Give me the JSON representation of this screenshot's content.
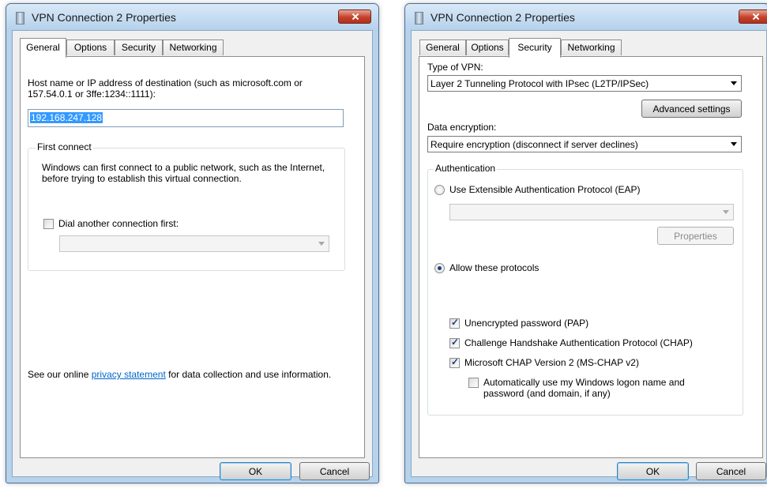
{
  "general_dialog": {
    "title": "VPN Connection 2 Properties",
    "tabs": [
      "General",
      "Options",
      "Security",
      "Networking"
    ],
    "active_tab": "General",
    "host_label": "Host name or IP address of destination (such as microsoft.com or 157.54.0.1 or 3ffe:1234::1111):",
    "host_value": "192.168.247.128",
    "first_connect": {
      "legend": "First connect",
      "description": "Windows can first connect to a public network, such as the Internet, before trying to establish this virtual connection.",
      "dial_label": "Dial another connection first:",
      "dial_checked": false,
      "dial_value": ""
    },
    "privacy_prefix": "See our online ",
    "privacy_link": "privacy statement",
    "privacy_suffix": " for data collection and use information.",
    "ok_label": "OK",
    "cancel_label": "Cancel"
  },
  "security_dialog": {
    "title": "VPN Connection 2 Properties",
    "tabs": [
      "General",
      "Options",
      "Security",
      "Networking"
    ],
    "active_tab": "Security",
    "vpn_type_label": "Type of VPN:",
    "vpn_type_value": "Layer 2 Tunneling Protocol with IPsec (L2TP/IPSec)",
    "advanced_label": "Advanced settings",
    "encryption_label": "Data encryption:",
    "encryption_value": "Require encryption (disconnect if server declines)",
    "authentication": {
      "legend": "Authentication",
      "eap_label": "Use Extensible Authentication Protocol (EAP)",
      "eap_selected": false,
      "eap_value": "",
      "properties_label": "Properties",
      "allow_label": "Allow these protocols",
      "allow_selected": true,
      "protocols": [
        {
          "label": "Unencrypted password (PAP)",
          "checked": true
        },
        {
          "label": "Challenge Handshake Authentication Protocol (CHAP)",
          "checked": true
        },
        {
          "label": "Microsoft CHAP Version 2 (MS-CHAP v2)",
          "checked": true
        }
      ],
      "auto_logon_label": "Automatically use my Windows logon name and password (and domain, if any)",
      "auto_logon_checked": false
    },
    "ok_label": "OK",
    "cancel_label": "Cancel"
  }
}
